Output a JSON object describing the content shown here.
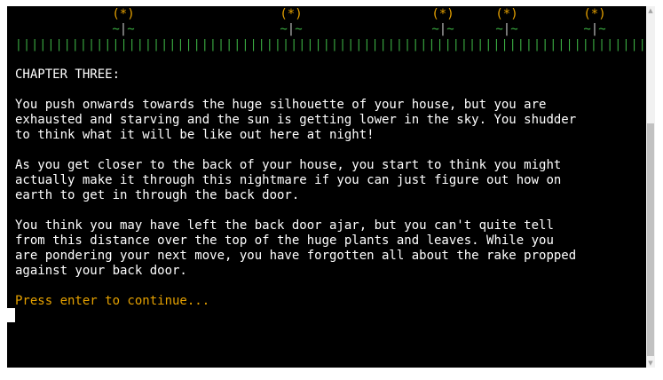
{
  "colors": {
    "background": "#000000",
    "text": "#ffffff",
    "prompt": "#e5a100",
    "grass": "#3cb043"
  },
  "decor": {
    "flower_head": "(*)",
    "flower_stem_left": "~",
    "flower_stem_mid": "|",
    "flower_stem_right": "~",
    "grass_line": "|||||||||||||||||||||||||||||||||||||||||||||||||||||||||||||||||||||||||||||||||||||||||||||||||||||||||||"
  },
  "story": {
    "chapter_title": "CHAPTER THREE:",
    "p1": [
      "You push onwards towards the huge silhouette of your house, but you are",
      "exhausted and starving and the sun is getting lower in the sky. You shudder",
      "to think what it will be like out here at night!"
    ],
    "p2": [
      "As you get closer to the back of your house, you start to think you might",
      "actually make it through this nightmare if you can just figure out how on",
      "earth to get in through the back door."
    ],
    "p3": [
      "You think you may have left the back door ajar, but you can't quite tell",
      "from this distance over the top of the huge plants and leaves. While you",
      "are pondering your next move, you have forgotten all about the rake propped",
      "against your back door."
    ],
    "prompt": "Press enter to continue..."
  },
  "scrollbar": {
    "up_icon": "▲",
    "down_icon": "▼"
  }
}
